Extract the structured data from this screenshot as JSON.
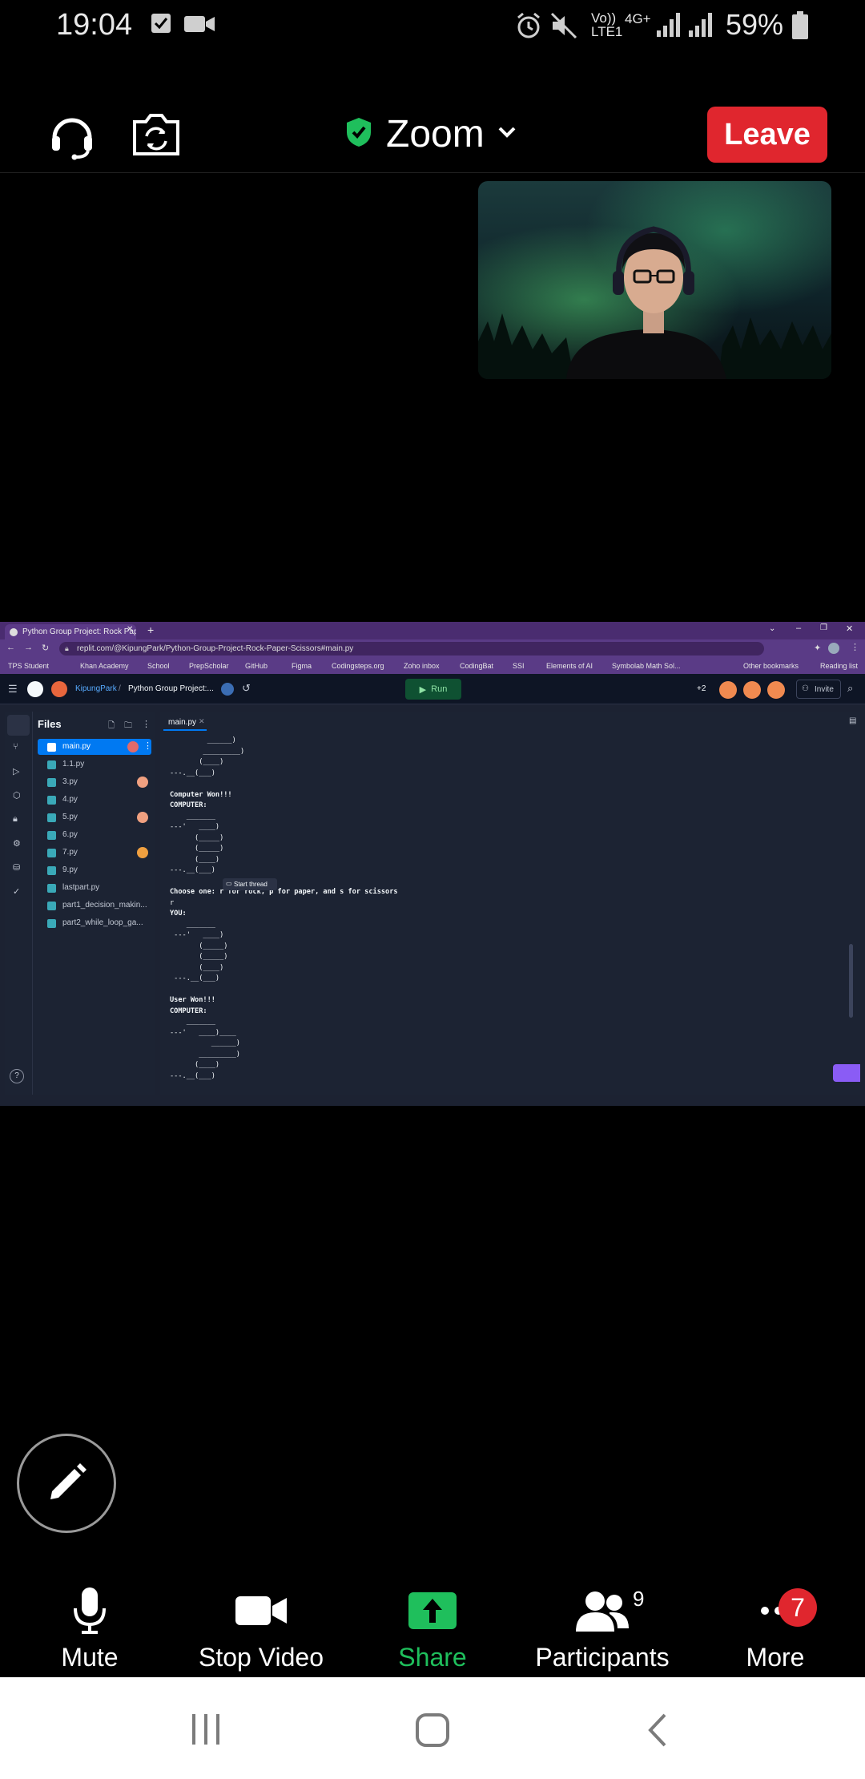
{
  "status_bar": {
    "time": "19:04",
    "network_label": "Vo)) LTE1",
    "data_label": "4G+",
    "battery": "59%"
  },
  "meeting": {
    "title": "Zoom",
    "leave_label": "Leave",
    "colors": {
      "leave": "#e0262e",
      "shield": "#1fbf5c",
      "share": "#1fbf5c"
    }
  },
  "browser": {
    "tab_title": "Python Group Project: Rock Pape",
    "url": "replit.com/@KipungPark/Python-Group-Project-Rock-Paper-Scissors#main.py",
    "bookmarks": [
      "TPS Student",
      "Khan Academy",
      "School",
      "PrepScholar",
      "GitHub",
      "Figma",
      "Codingsteps.org",
      "Zoho inbox",
      "CodingBat",
      "SSI",
      "Elements of AI",
      "Symbolab Math Sol...",
      "Other bookmarks",
      "Reading list"
    ]
  },
  "replit": {
    "user": "KipungPark",
    "project": "Python Group Project:...",
    "run_label": "Run",
    "extra_users": "+2",
    "invite_label": "Invite",
    "files_header": "Files",
    "files": [
      "main.py",
      "1.1.py",
      "3.py",
      "4.py",
      "5.py",
      "6.py",
      "7.py",
      "9.py",
      "lastpart.py",
      "part1_decision_makin...",
      "part2_while_loop_ga..."
    ],
    "editor_tab": "main.py",
    "start_thread_label": "Start thread",
    "console_lines": [
      "         ______)",
      "        _________)",
      "       (____)",
      "---.__(___)",
      "",
      "Computer Won!!!",
      "COMPUTER:",
      "    _______",
      "---'   ____)",
      "      (_____)",
      "      (_____)",
      "      (____)",
      "---.__(___)",
      "",
      "Choose one: r for rock, p for paper, and s for scissors",
      "r",
      "YOU:",
      "    _______",
      " ---'   ____)",
      "       (_____)",
      "       (_____)",
      "       (____)",
      " ---.__(___)",
      "",
      "User Won!!!",
      "COMPUTER:",
      "    _______",
      "---'   ____)____",
      "          ______)",
      "       _________)",
      "      (____)",
      "---.__(___)"
    ]
  },
  "toolbar": {
    "mute": "Mute",
    "stop_video": "Stop Video",
    "share": "Share",
    "participants": "Participants",
    "participants_count": "9",
    "more": "More",
    "more_badge": "7"
  }
}
